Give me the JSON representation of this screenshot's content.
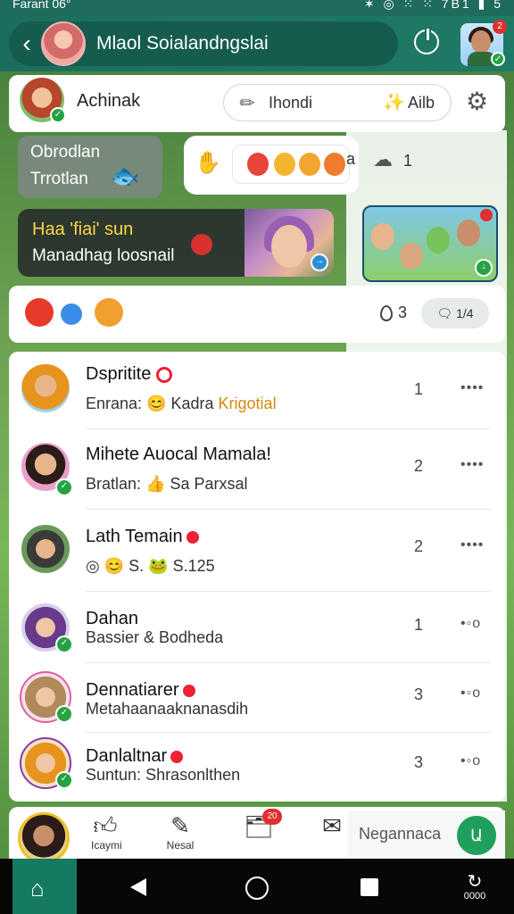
{
  "status_bar": {
    "left_text": "Farant  06°",
    "right_text": "✶ ◎ ⁙ ⁙ 7B1 ▮ 5"
  },
  "header": {
    "title": "Mlaol Soialandngslai",
    "right_avatar_badge": "2"
  },
  "profile": {
    "name": "Achinak"
  },
  "search_pill": {
    "label_left": "Ihondi",
    "label_right": "Ailb"
  },
  "messages": [
    {
      "line1": "Obrodlan",
      "line2": "Trrotlan"
    },
    {
      "line1": "Haa 'fiai' sun",
      "line2": "Manadhag loosnail"
    }
  ],
  "reaction_bar": {
    "count_prefix": "a",
    "count": "1"
  },
  "reaction_row": {
    "likes": "3",
    "reply": "1/4"
  },
  "conversations": [
    {
      "name": "Dspritite",
      "sub_prefix": "Enrana:",
      "sub_text": "Kadra",
      "sub_highlight": "Krigotial",
      "count": "1",
      "more": "••••"
    },
    {
      "name": "Mihete Auocal Mamala!",
      "sub_prefix": "Bratlan:",
      "sub_text": "Sa Parxsal",
      "count": "2",
      "more": "••••"
    },
    {
      "name": "Lath Temain",
      "sub_prefix": "",
      "sub_text": "S.",
      "sub_text2": "S.125",
      "count": "2",
      "more": "••••"
    },
    {
      "name": "Dahan",
      "sub_prefix": "",
      "sub_text": "Bassier & Bodheda",
      "count": "1",
      "more": "•◦o"
    },
    {
      "name": "Dennatiarer",
      "sub_prefix": "",
      "sub_text": "Metahaanaaknanasdih",
      "count": "3",
      "more": "•◦o"
    },
    {
      "name": "Danlaltnar",
      "sub_prefix": "Suntun:",
      "sub_text": "Shrasonlthen",
      "count": "3",
      "more": "•◦o"
    }
  ],
  "bottom_nav": {
    "items": [
      {
        "label": "Icaymi"
      },
      {
        "label": "Nesal"
      },
      {
        "label": "",
        "badge": "20"
      },
      {
        "label": ""
      }
    ],
    "compose_placeholder": "Negannaca",
    "compose_button": "Ա"
  },
  "system_nav": {
    "right_label": "0000"
  }
}
